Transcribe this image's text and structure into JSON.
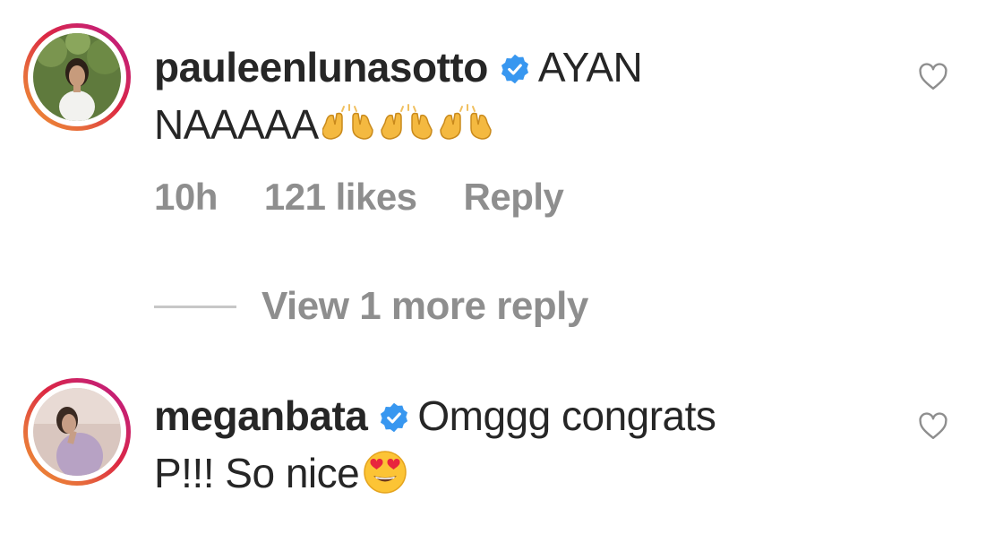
{
  "comments": [
    {
      "username": "pauleenlunasotto",
      "verified": true,
      "text_line1": "AYAN",
      "text_line2": "NAAAAA",
      "emoji": "raising-hands-emoji x3",
      "time": "10h",
      "likes": "121 likes",
      "reply": "Reply",
      "avatar_icon": "avatar-pauleenlunasotto",
      "like_icon": "heart-outline-icon"
    },
    {
      "username": "meganbata",
      "verified": true,
      "text_line1": "Omggg congrats",
      "text_line2": "P!!! So nice",
      "emoji": "heart-eyes-emoji",
      "avatar_icon": "avatar-meganbata",
      "like_icon": "heart-outline-icon"
    }
  ],
  "view_replies": "View 1 more reply",
  "colors": {
    "text": "#262626",
    "secondary": "#8e8e8e",
    "verified": "#3897f0",
    "divider": "#c7c7c7"
  }
}
